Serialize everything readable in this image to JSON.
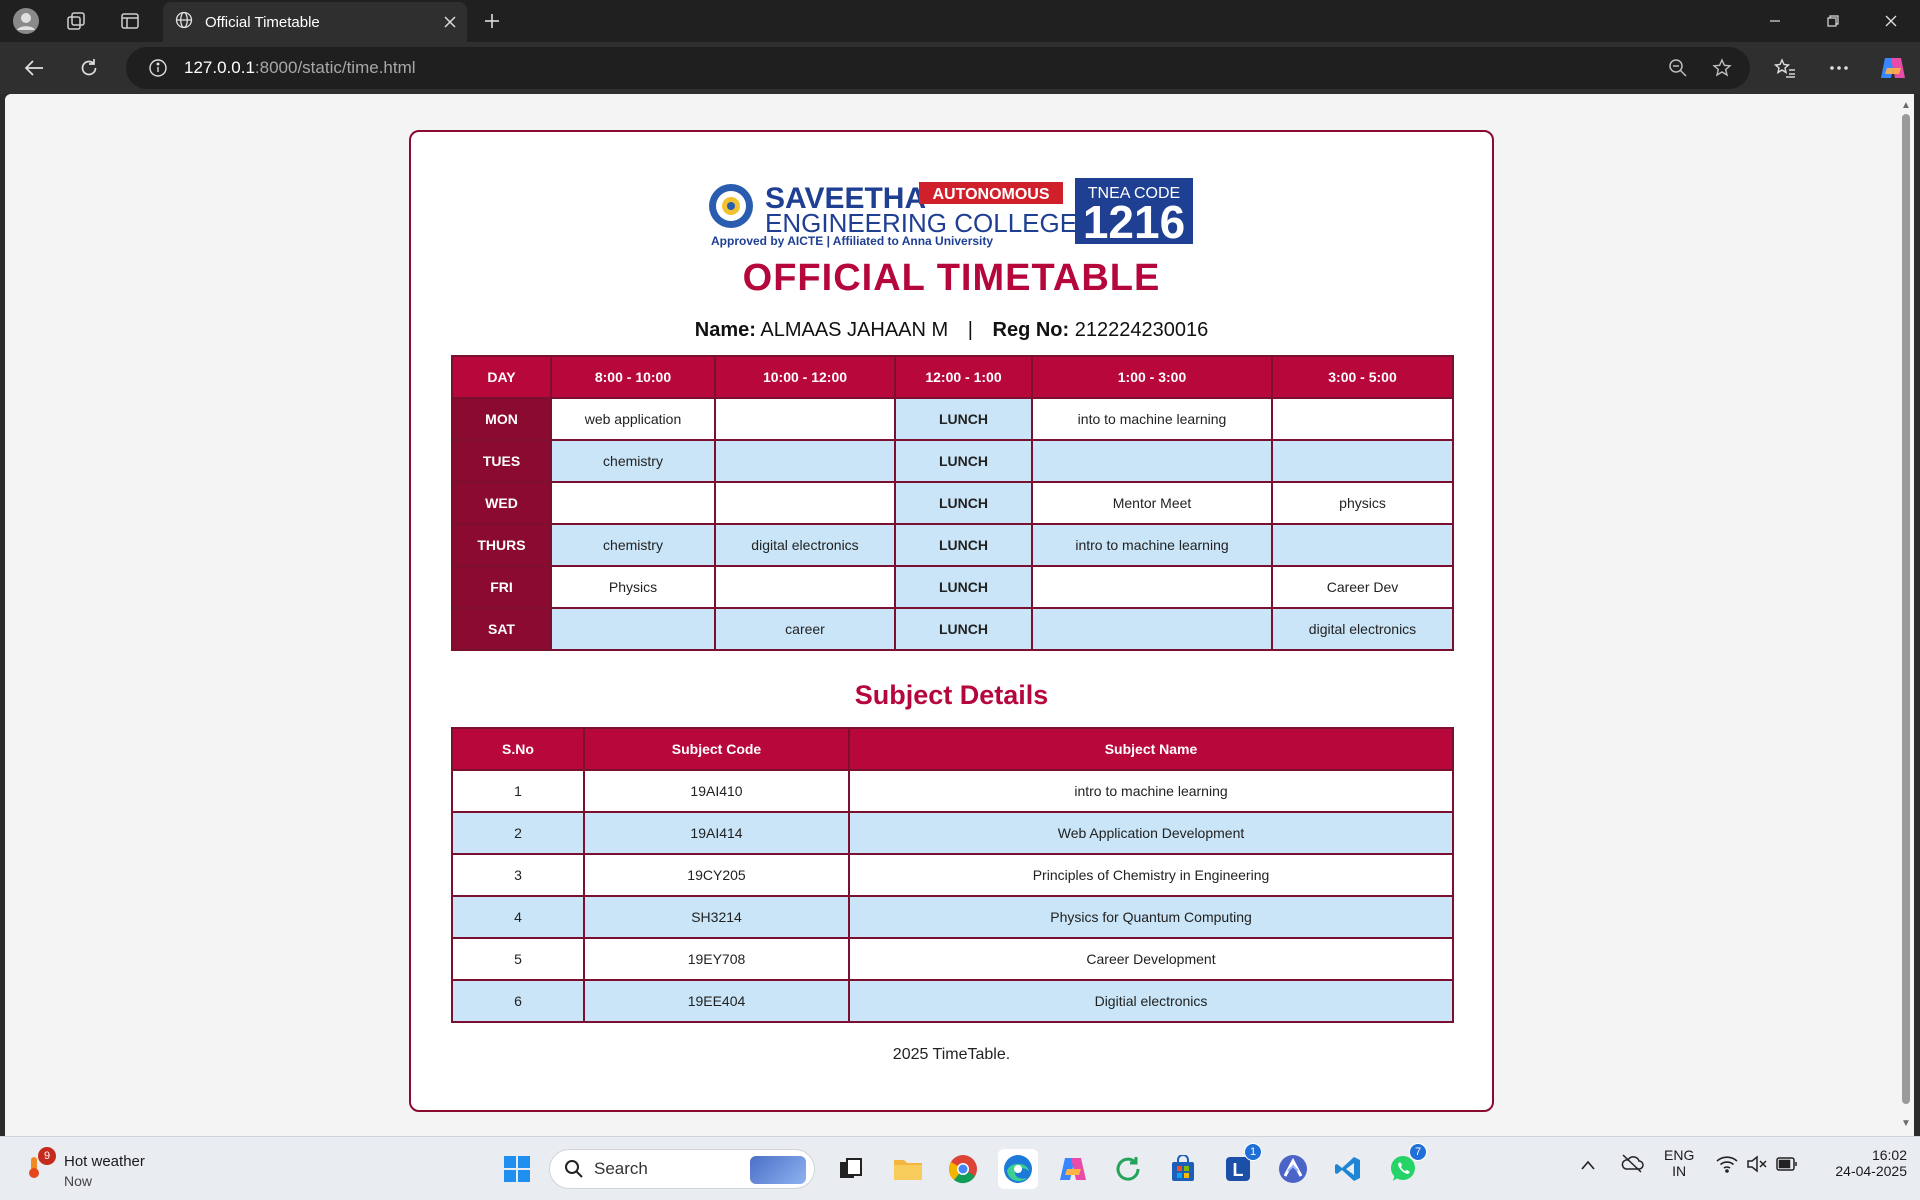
{
  "browser": {
    "tab_title": "Official Timetable",
    "url_host": "127.0.0.1",
    "url_rest": ":8000/static/time.html"
  },
  "logo": {
    "name_line1": "SAVEETHA",
    "autonomous": "AUTONOMOUS",
    "name_line2": "ENGINEERING COLLEGE",
    "tagline": "Approved by AICTE  |  Affiliated to Anna University",
    "tnea_label": "TNEA CODE",
    "tnea_code": "1216"
  },
  "page": {
    "heading": "OFFICIAL TIMETABLE",
    "name_label": "Name:",
    "name_value": "ALMAAS JAHAAN M",
    "separator": "|",
    "reg_label": "Reg No:",
    "reg_value": "212224230016",
    "subjects_title": "Subject Details",
    "footer": "2025 TimeTable."
  },
  "timetable": {
    "headers": [
      "DAY",
      "8:00 - 10:00",
      "10:00 - 12:00",
      "12:00 - 1:00",
      "1:00 - 3:00",
      "3:00 - 5:00"
    ],
    "rows": [
      {
        "day": "MON",
        "slot1": "web application",
        "slot2": "",
        "lunch": "LUNCH",
        "slot3": "into to machine learning",
        "slot4": ""
      },
      {
        "day": "TUES",
        "slot1": "chemistry",
        "slot2": "",
        "lunch": "LUNCH",
        "slot3": "",
        "slot4": ""
      },
      {
        "day": "WED",
        "slot1": "",
        "slot2": "",
        "lunch": "LUNCH",
        "slot3": "Mentor Meet",
        "slot4": "physics"
      },
      {
        "day": "THURS",
        "slot1": "chemistry",
        "slot2": "digital electronics",
        "lunch": "LUNCH",
        "slot3": "intro to machine learning",
        "slot4": ""
      },
      {
        "day": "FRI",
        "slot1": "Physics",
        "slot2": "",
        "lunch": "LUNCH",
        "slot3": "",
        "slot4": "Career Dev"
      },
      {
        "day": "SAT",
        "slot1": "",
        "slot2": "career",
        "lunch": "LUNCH",
        "slot3": "",
        "slot4": "digital electronics"
      }
    ]
  },
  "subjects": {
    "headers": [
      "S.No",
      "Subject Code",
      "Subject Name"
    ],
    "rows": [
      {
        "sno": "1",
        "code": "19AI410",
        "name": "intro to machine learning"
      },
      {
        "sno": "2",
        "code": "19AI414",
        "name": "Web Application Development"
      },
      {
        "sno": "3",
        "code": "19CY205",
        "name": "Principles of Chemistry in Engineering"
      },
      {
        "sno": "4",
        "code": "SH3214",
        "name": "Physics for Quantum Computing"
      },
      {
        "sno": "5",
        "code": "19EY708",
        "name": "Career Development"
      },
      {
        "sno": "6",
        "code": "19EE404",
        "name": "Digitial electronics"
      }
    ]
  },
  "taskbar": {
    "weather_title": "Hot weather",
    "weather_sub": "Now",
    "weather_badge": "9",
    "search_label": "Search",
    "badge_l": "1",
    "badge_whatsapp": "7",
    "lang_line1": "ENG",
    "lang_line2": "IN",
    "time": "16:02",
    "date": "24-04-2025"
  },
  "colors": {
    "accent": "#b8073b",
    "day_cell": "#8b0a2f",
    "alt_row": "#c9e5f7"
  }
}
